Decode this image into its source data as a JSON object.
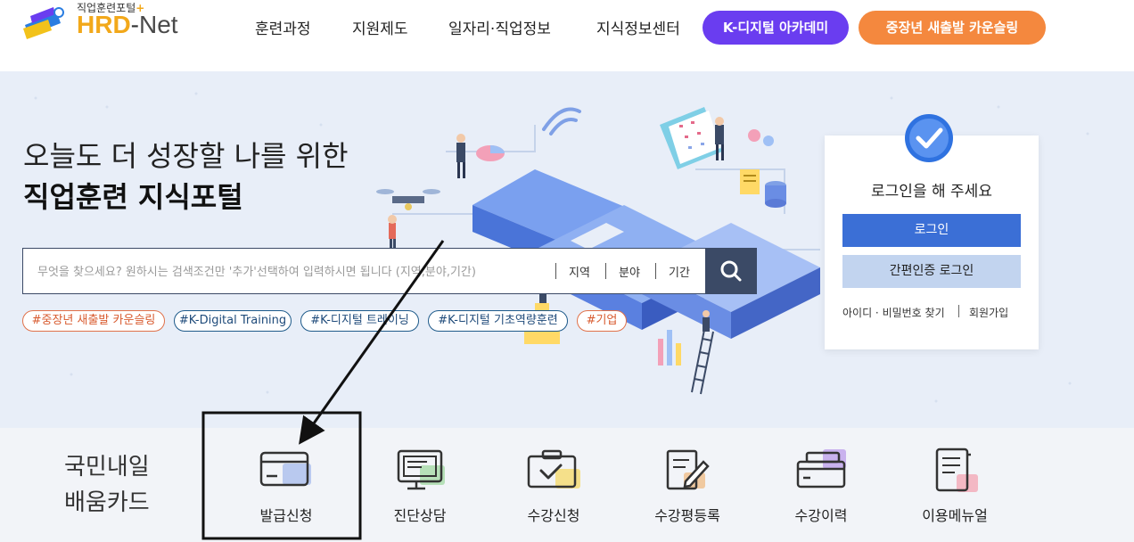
{
  "header": {
    "logo_small": "직업훈련포털",
    "logo_plus": "+",
    "logo_brand": "HRD",
    "logo_dash": "-",
    "logo_net": "Net",
    "nav": [
      "훈련과정",
      "지원제도",
      "일자리·직업정보",
      "지식정보센터"
    ],
    "pill_purple": "K-디지털 아카데미",
    "pill_orange": "중장년 새출발 카운슬링"
  },
  "hero": {
    "title_line1": "오늘도 더 성장할 나를 위한",
    "title_line2": "직업훈련 지식포털",
    "search_placeholder": "무엇을 찾으세요? 원하시는 검색조건만 '추가'선택하여 입력하시면 됩니다 (지역,분야,기간)",
    "filters": [
      "지역",
      "분야",
      "기간"
    ],
    "search_icon": "search-icon",
    "tags": [
      "#중장년 새출발 카운슬링",
      "#K-Digital Training",
      "#K-디지털 트레이닝",
      "#K-디지털 기초역량훈련",
      "#기업"
    ]
  },
  "login": {
    "message": "로그인을 해 주세요",
    "login_button": "로그인",
    "simple_login_button": "간편인증 로그인",
    "find_link": "아이디 · 비밀번호 찾기",
    "join_link": "회원가입"
  },
  "card": {
    "title_line1": "국민내일",
    "title_line2": "배움카드",
    "items": [
      {
        "label": "발급신청",
        "icon": "card-issue-icon"
      },
      {
        "label": "진단상담",
        "icon": "consult-icon"
      },
      {
        "label": "수강신청",
        "icon": "course-apply-icon"
      },
      {
        "label": "수강평등록",
        "icon": "review-icon"
      },
      {
        "label": "수강이력",
        "icon": "history-icon"
      },
      {
        "label": "이용메뉴얼",
        "icon": "manual-icon"
      }
    ]
  },
  "colors": {
    "brand_orange": "#f2a81a",
    "pill_purple": "#6a3df0",
    "pill_orange": "#f4883e",
    "login_blue": "#3b6fd6",
    "search_dark": "#3b4a66"
  }
}
